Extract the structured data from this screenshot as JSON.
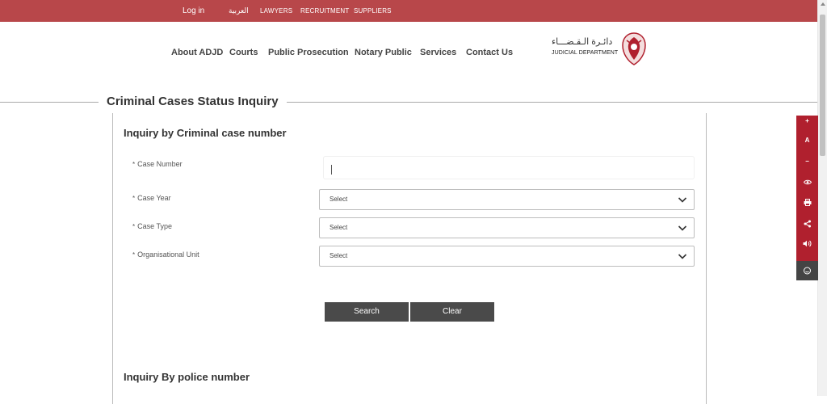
{
  "topbar": {
    "login": "Log in",
    "arabic": "العربية",
    "lawyers": "LAWYERS",
    "recruitment": "RECRUITMENT",
    "suppliers": "SUPPLIERS",
    "color": "#b8474a"
  },
  "nav": {
    "about": "About ADJD",
    "courts": "Courts",
    "prosecution": "Public Prosecution",
    "notary": "Notary Public",
    "services": "Services",
    "contact": "Contact Us"
  },
  "logo": {
    "arabic": "دائـرة الـقـضـــاء",
    "english": "JUDICIAL DEPARTMENT"
  },
  "page": {
    "title": "Criminal Cases Status Inquiry"
  },
  "form": {
    "section1_title": "Inquiry by Criminal case number",
    "required_mark": "*",
    "case_number_label": "Case Number",
    "case_year_label": "Case Year",
    "case_type_label": "Case Type",
    "org_unit_label": "Organisational Unit",
    "case_year_value": "Select",
    "case_type_value": "Select",
    "org_unit_value": "Select",
    "search_label": "Search",
    "clear_label": "Clear",
    "section2_title": "Inquiry By police number"
  },
  "accessibility": {
    "color": "#b0202e",
    "items": [
      "+",
      "A",
      "−"
    ],
    "icons": [
      "eye-icon",
      "print-icon",
      "share-icon",
      "speaker-icon",
      "chat-icon"
    ]
  }
}
